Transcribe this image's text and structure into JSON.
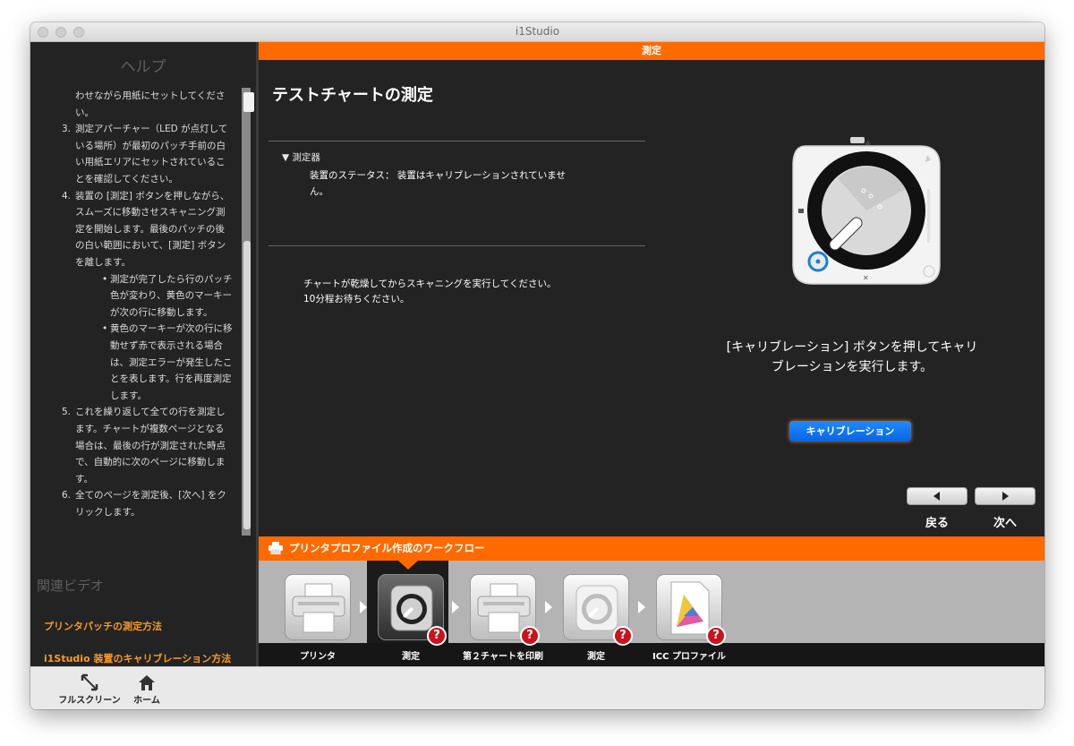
{
  "window": {
    "title": "i1Studio"
  },
  "help": {
    "title": "ヘルプ",
    "lines": [
      "わせながら用紙にセットしてくださ",
      "い。",
      "3.",
      "測定アパーチャー（LED が点灯して",
      "いる場所）が最初のパッチ手前の白",
      "い用紙エリアにセットされているこ",
      "とを確認してください。",
      "4.",
      "装置の [測定] ボタンを押しながら、",
      "スムーズに移動させスキャニング測",
      "定を開始します。最後のパッチの後",
      "の白い範囲において、[測定] ボタン",
      "を離します。",
      "•",
      "測定が完了したら行のパッチ",
      "色が変わり、黄色のマーキー",
      "が次の行に移動します。",
      "•",
      "黄色のマーキーが次の行に移",
      "動せず赤で表示される場合",
      "は、測定エラーが発生したこ",
      "とを表します。行を再度測定",
      "します。",
      "5.",
      "これを繰り返して全ての行を測定し",
      "ます。チャートが複数ページとなる",
      "場合は、最後の行が測定された時点",
      "で、自動的に次のページに移動しま",
      "す。",
      "6.",
      "全てのページを測定後、[次へ] をク",
      "リックします。"
    ],
    "videos_title": "関連ビデオ",
    "videos": [
      "プリンタパッチの測定方法",
      "i1Studio 装置のキャリブレーション方法"
    ]
  },
  "main": {
    "header": "測定",
    "page_title": "テストチャートの測定",
    "section": "▼ 測定器",
    "status_line1": "装置のステータス： 装置はキャリブレーションされていませ",
    "status_line2": "ん。",
    "wait_line1": "チャートが乾燥してからスキャニングを実行してください。",
    "wait_line2": "10分程お待ちください。",
    "calib_msg_line1": "[キャリブレーション] ボタンを押してキャリ",
    "calib_msg_line2": "ブレーションを実行します。",
    "calib_button": "キャリブレーション",
    "back_label": "戻る",
    "next_label": "次へ"
  },
  "workflow": {
    "title": "プリンタプロファイル作成のワークフロー",
    "steps": [
      {
        "label": "プリンタ",
        "icon": "printer-icon",
        "badge": ""
      },
      {
        "label": "測定",
        "icon": "measure-device-icon",
        "badge": "?"
      },
      {
        "label": "第２チャートを印刷",
        "icon": "printer-icon",
        "badge": "?"
      },
      {
        "label": "測定",
        "icon": "measure-device-icon",
        "badge": "?"
      },
      {
        "label": "ICC プロファイル",
        "icon": "icc-profile-icon",
        "badge": "?"
      }
    ]
  },
  "footer": {
    "fullscreen": "フルスクリーン",
    "home": "ホーム"
  },
  "colors": {
    "accent": "#ff6a00",
    "button_blue": "#1f8bff",
    "link": "#f79a2e",
    "badge_red": "#c8141c"
  }
}
